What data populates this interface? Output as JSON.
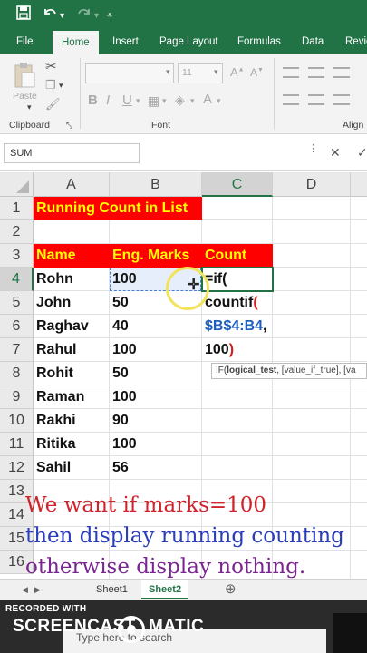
{
  "ribbon": {
    "tabs": [
      "File",
      "Home",
      "Insert",
      "Page Layout",
      "Formulas",
      "Data",
      "Revie"
    ],
    "active_tab": "Home",
    "paste_label": "Paste",
    "font_size": "11",
    "groups": {
      "clipboard": "Clipboard",
      "font": "Font",
      "alignment": "Align"
    }
  },
  "formula_bar": {
    "name_box": "SUM",
    "cancel_icon": "close-icon",
    "enter_icon": "check-icon"
  },
  "grid": {
    "columns": [
      "A",
      "B",
      "C",
      "D"
    ],
    "rows": [
      "1",
      "2",
      "3",
      "4",
      "5",
      "6",
      "7",
      "8",
      "9",
      "10",
      "11",
      "12",
      "13",
      "14",
      "15",
      "16"
    ],
    "title": "Running Count in List",
    "headers": {
      "name": "Name",
      "marks": "Eng. Marks",
      "count": "Count"
    },
    "records": [
      {
        "name": "Rohn",
        "marks": "100"
      },
      {
        "name": "John",
        "marks": "50"
      },
      {
        "name": "Raghav",
        "marks": "40"
      },
      {
        "name": "Rahul",
        "marks": "100"
      },
      {
        "name": "Rohit",
        "marks": "50"
      },
      {
        "name": "Raman",
        "marks": "100"
      },
      {
        "name": "Rakhi",
        "marks": "90"
      },
      {
        "name": "Ritika",
        "marks": "100"
      },
      {
        "name": "Sahil",
        "marks": "56"
      }
    ],
    "formula_lines": {
      "line1": "=if(",
      "line2_text": "countif",
      "line2_paren": "(",
      "line3": "$B$4:B4",
      "line3_comma": ",",
      "line4_text": "100",
      "line4_paren": ")"
    },
    "tooltip": {
      "prefix": "IF(",
      "bold_arg": "logical_test",
      "rest": ", [value_if_true], [va"
    }
  },
  "annotation": {
    "line1": "We want if marks=100",
    "line2": "then display running counting",
    "line3": "otherwise display nothing."
  },
  "sheets": {
    "tab1": "Sheet1",
    "tab2": "Sheet2",
    "active": "Sheet2"
  },
  "overlay": {
    "recorded_with": "RECORDED WITH",
    "logo_left": "SCREENCAST",
    "logo_right": "MATIC",
    "search_placeholder": "Type here to search"
  },
  "colors": {
    "excel_green": "#217346",
    "header_fill": "#ff0000",
    "header_text": "#ffff00",
    "annotation_red": "#d0242c",
    "annotation_blue": "#2a3dbb",
    "annotation_purple": "#7a2590"
  }
}
